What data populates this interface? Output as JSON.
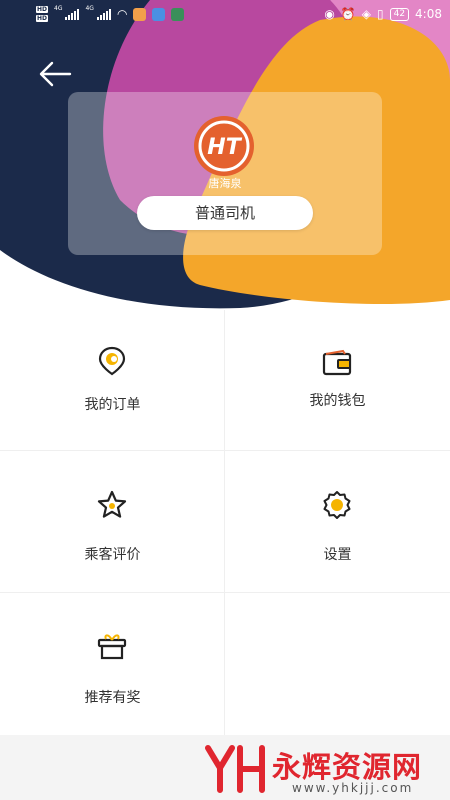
{
  "status_bar": {
    "net_1": "4G",
    "net_2": "4G",
    "battery": "42",
    "time": "4:08"
  },
  "profile": {
    "logo_text": "HT",
    "name": "唐海泉",
    "role": "普通司机"
  },
  "menu": [
    {
      "label": "我的订单",
      "icon": "order-pin-icon"
    },
    {
      "label": "我的钱包",
      "icon": "wallet-icon"
    },
    {
      "label": "乘客评价",
      "icon": "star-icon"
    },
    {
      "label": "设置",
      "icon": "gear-icon"
    },
    {
      "label": "推荐有奖",
      "icon": "gift-icon"
    }
  ],
  "watermark": {
    "title": "永辉资源网",
    "url": "www.yhkjjj.com"
  },
  "colors": {
    "navy": "#1b2a4a",
    "magenta": "#b8489f",
    "orange": "#f4a62a",
    "pink": "#e386c6",
    "accent_yellow": "#f5b400",
    "logo_red": "#e4612e",
    "watermark_red": "#e0262f"
  }
}
